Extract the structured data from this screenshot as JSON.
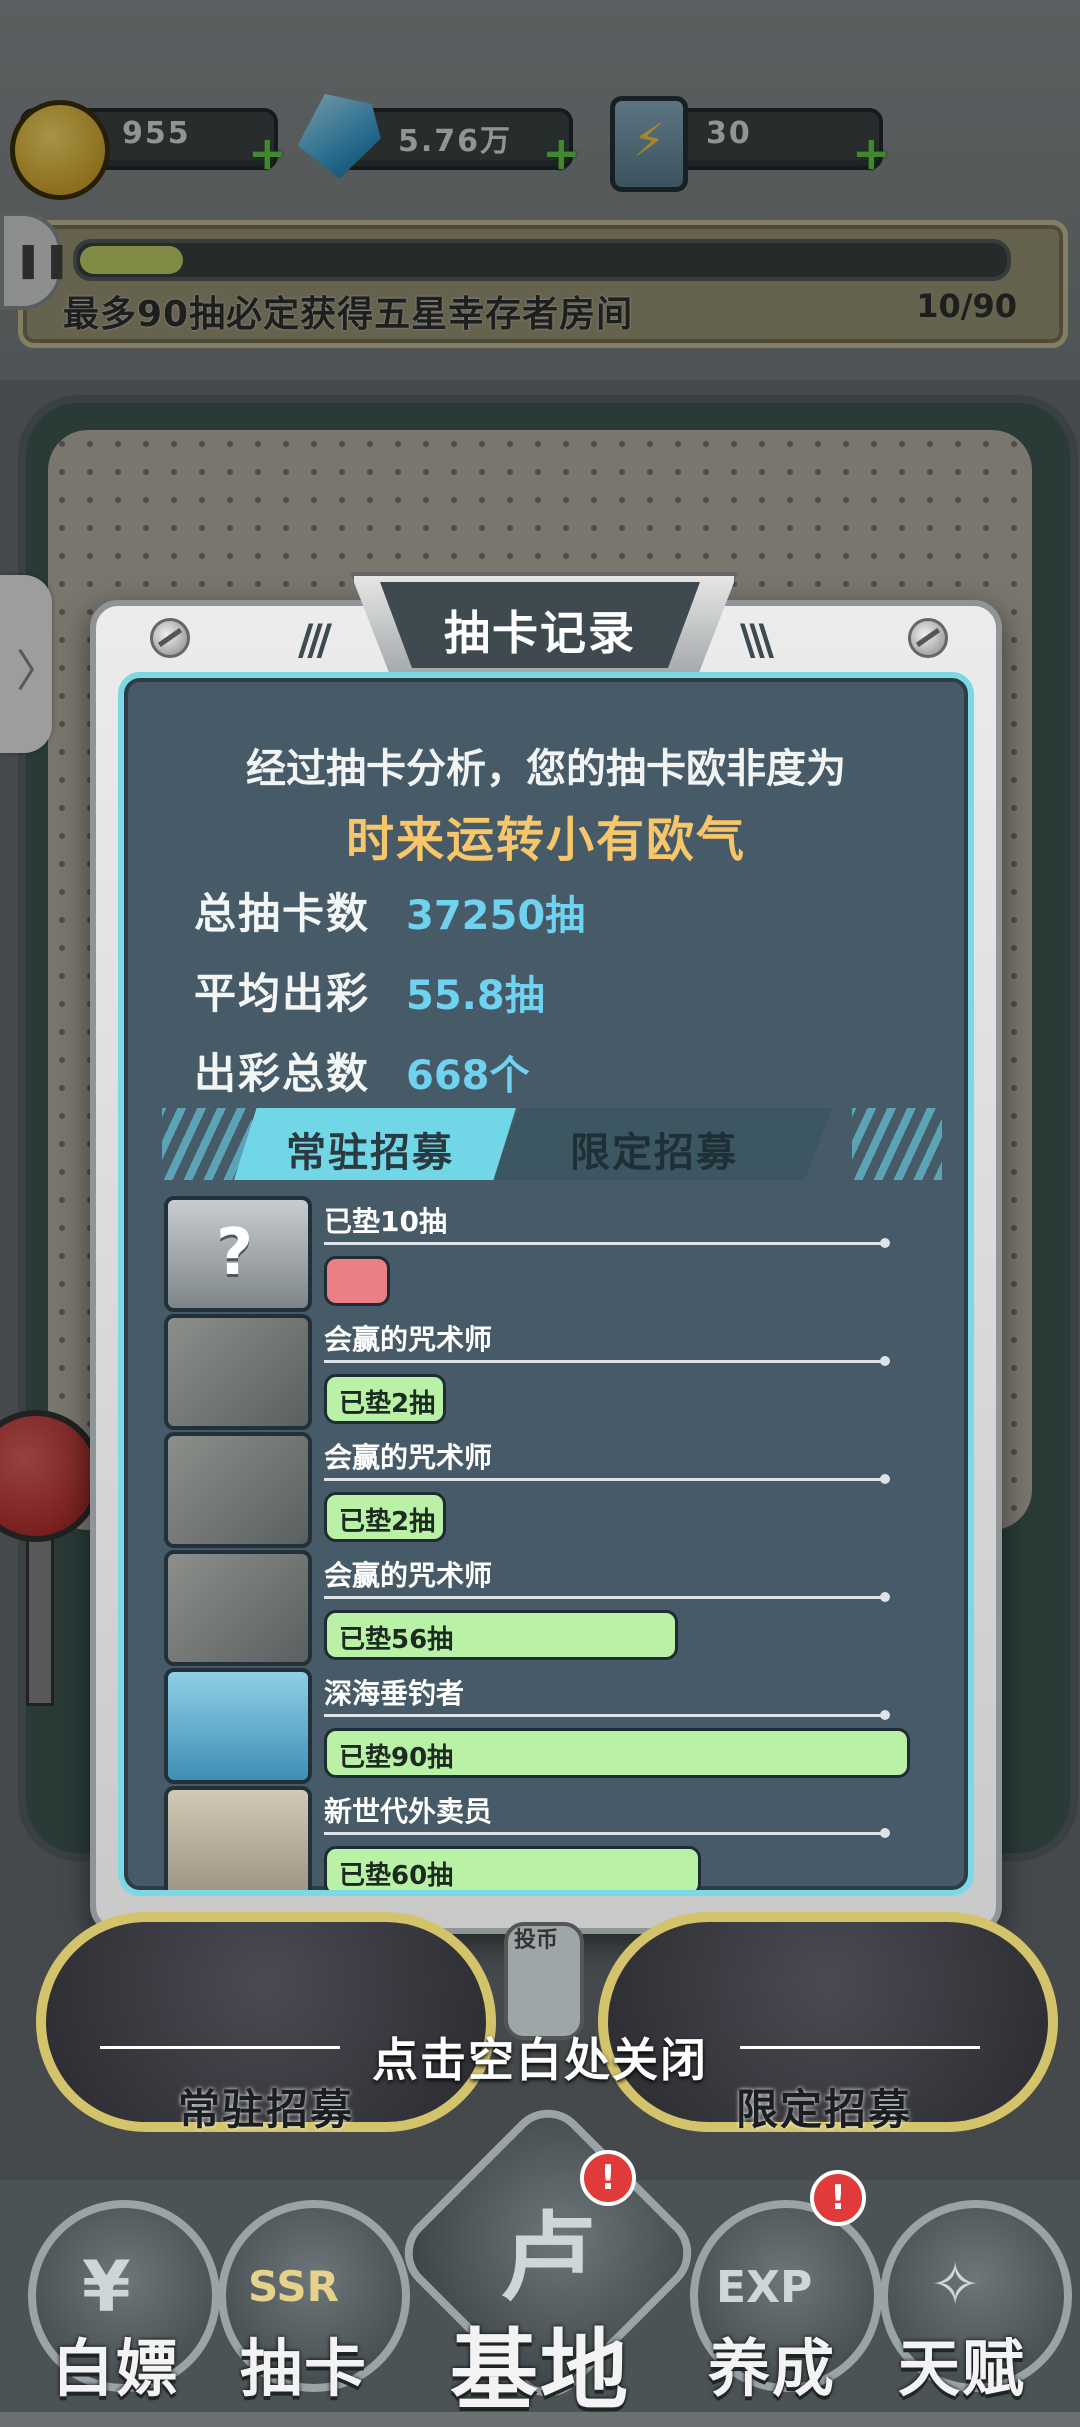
{
  "resources": {
    "coins": "955",
    "gems": "5.76万",
    "energy": "30",
    "plus": "+"
  },
  "banner": {
    "text": "最多90抽必定获得五星幸存者房间",
    "count": "10/90",
    "progress": 0.111
  },
  "modal": {
    "title": "抽卡记录",
    "analysis": "经过抽卡分析，您的抽卡欧非度为",
    "verdict": "时来运转小有欧气",
    "stats": [
      {
        "label": "总抽卡数",
        "value": "37250抽"
      },
      {
        "label": "平均出彩",
        "value": "55.8抽"
      },
      {
        "label": "出彩总数",
        "value": "668个"
      }
    ],
    "tabs": {
      "active": "常驻招募",
      "inactive": "限定招募"
    },
    "records": [
      {
        "name": "已垫10抽",
        "bar": "",
        "fill": 0.078,
        "avatar": "unknown",
        "qmark": "?"
      },
      {
        "name": "会赢的咒术师",
        "bar": "已垫2抽",
        "fill": 0.2,
        "avatar": "sorcerer"
      },
      {
        "name": "会赢的咒术师",
        "bar": "已垫2抽",
        "fill": 0.2,
        "avatar": "sorcerer"
      },
      {
        "name": "会赢的咒术师",
        "bar": "已垫56抽",
        "fill": 0.6,
        "avatar": "sorcerer"
      },
      {
        "name": "深海垂钓者",
        "bar": "已垫90抽",
        "fill": 1.0,
        "avatar": "angler"
      },
      {
        "name": "新世代外卖员",
        "bar": "已垫60抽",
        "fill": 0.64,
        "avatar": "courier"
      }
    ]
  },
  "coin_slot": "投币",
  "close_hint": "点击空白处关闭",
  "summon": {
    "standard": "常驻招募",
    "limited": "限定招募"
  },
  "nav": {
    "free": "白嫖",
    "gacha": "抽卡",
    "base": "基地",
    "train": "养成",
    "talent": "天赋",
    "badge": "!",
    "ssr": "SSR",
    "exp": "EXP"
  },
  "colors": {
    "panel": "#465a68",
    "panel_border": "#7bd8e4",
    "verdict": "#f7c66a",
    "stat_value": "#6fd2f0",
    "bar_green": "#b9f2a6",
    "bar_red": "#ea7f86"
  },
  "icons": {
    "coin": "coin-icon",
    "gem": "gem-icon",
    "energy": "battery-icon",
    "pause": "pause-icon",
    "side": "chevron-right-icon"
  }
}
